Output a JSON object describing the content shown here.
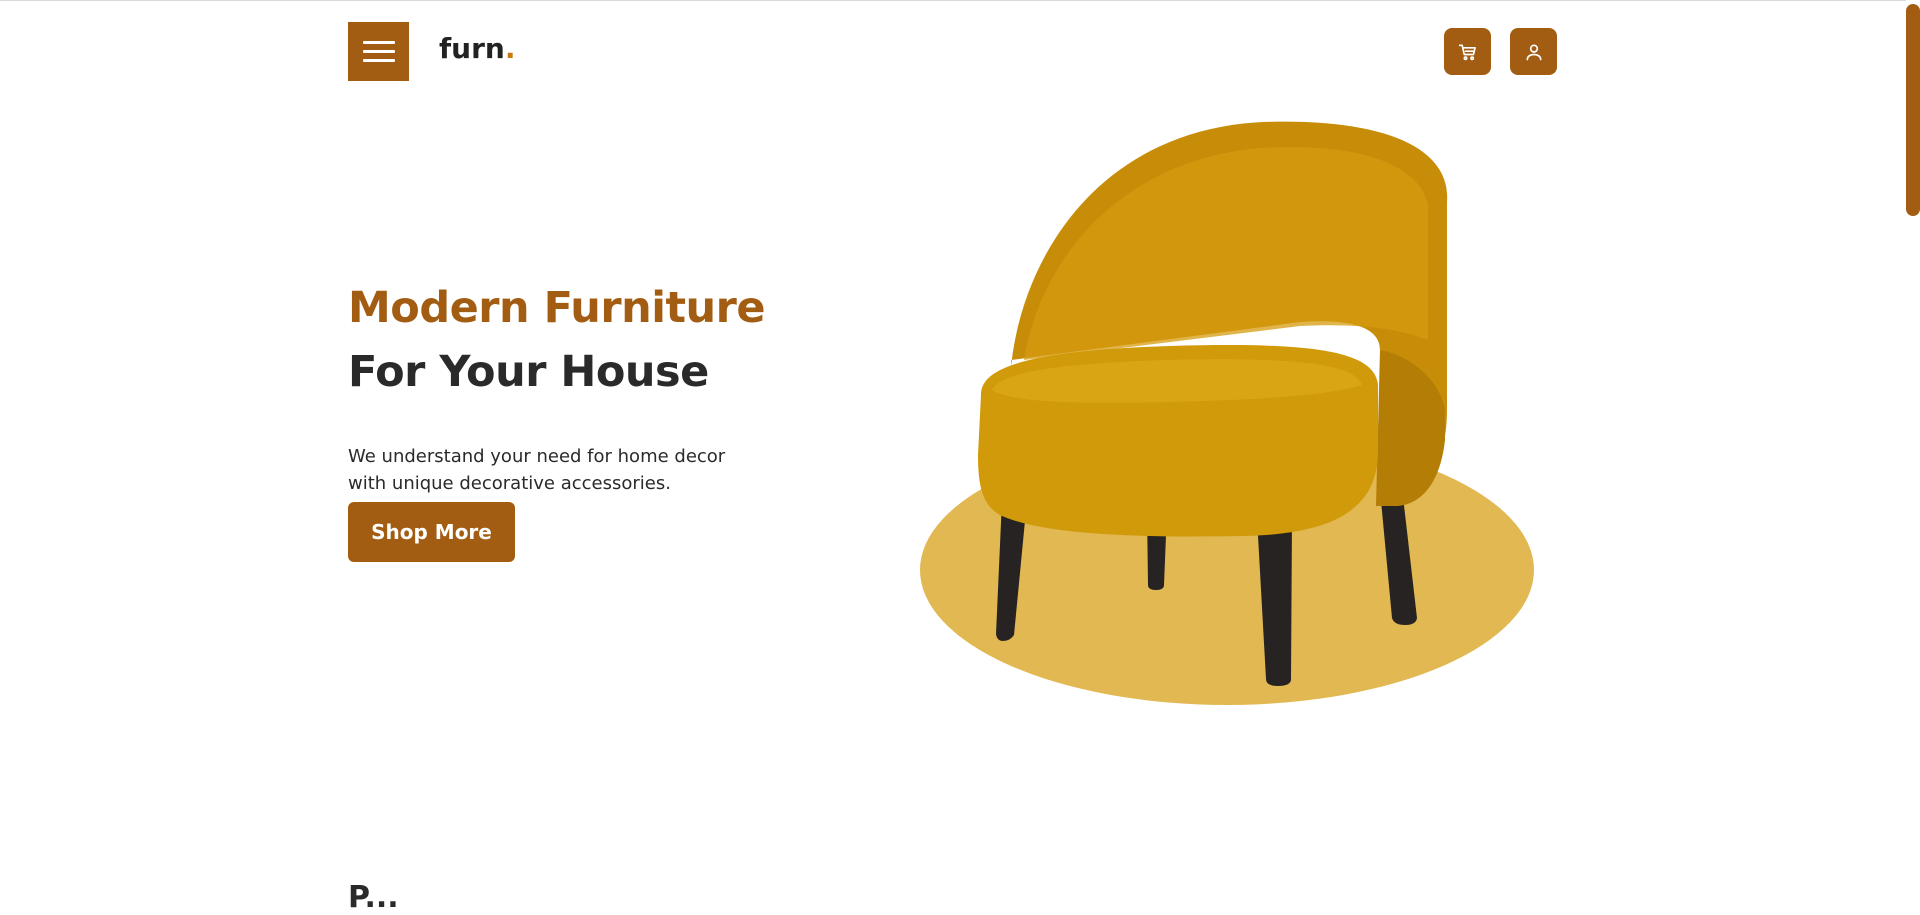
{
  "header": {
    "logo_text": "furn",
    "logo_dot": ".",
    "menu_icon": "hamburger-icon",
    "cart_icon": "cart-icon",
    "user_icon": "user-icon"
  },
  "hero": {
    "title_line1": "Modern Furniture",
    "title_line2": "For Your House",
    "description": "We understand your need for home decor with unique decorative accessories.",
    "cta_label": "Shop More",
    "image_subject": "armchair-illustration"
  },
  "next_section": {
    "heading_partial": "P..."
  },
  "colors": {
    "accent": "#A25D13",
    "accent_light": "#E1B851",
    "chair": "#D19A0B",
    "text_dark": "#2a2a2a",
    "background": "#ffffff"
  }
}
